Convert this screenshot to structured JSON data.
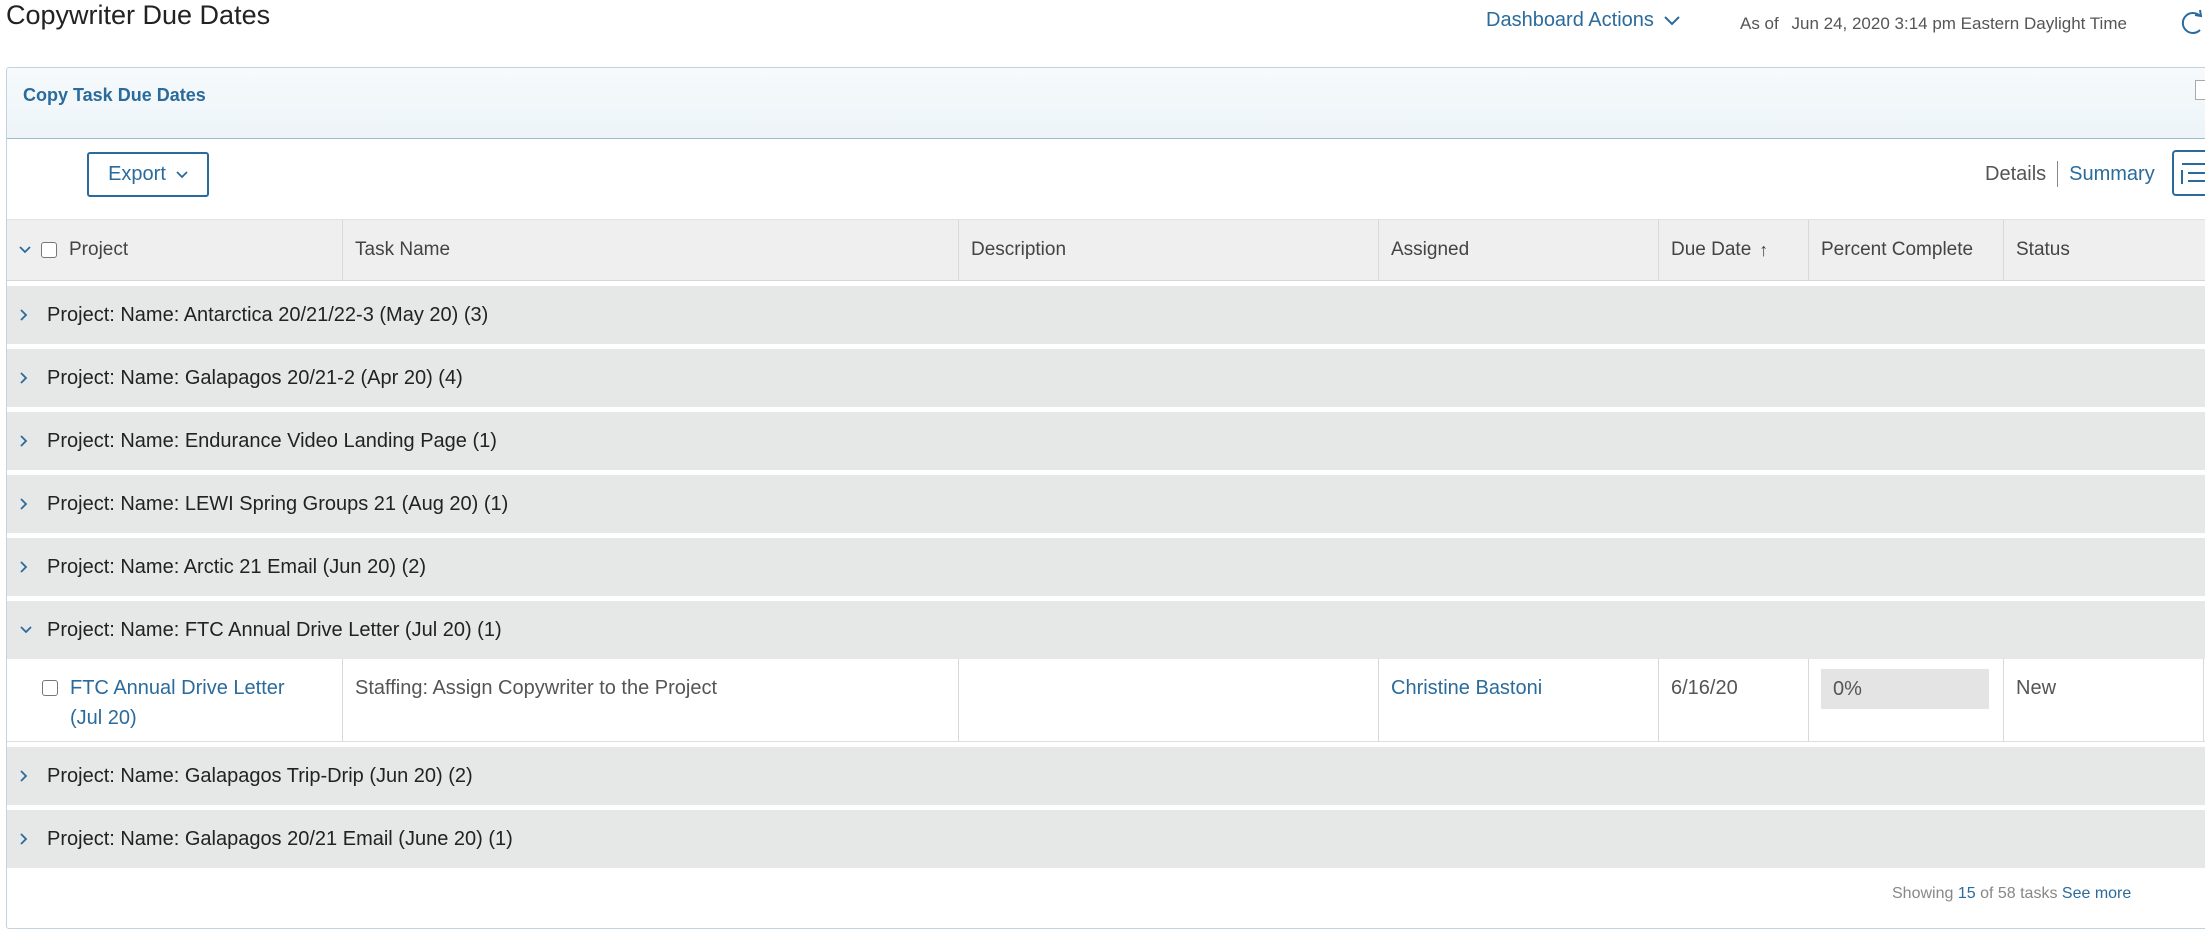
{
  "page": {
    "title": "Copywriter Due Dates",
    "dashboard_actions": "Dashboard Actions",
    "as_of_label": "As of",
    "as_of_value": "Jun 24, 2020 3:14 pm Eastern Daylight Time"
  },
  "panel": {
    "title": "Copy Task Due Dates"
  },
  "toolbar": {
    "export_label": "Export",
    "details_label": "Details",
    "summary_label": "Summary"
  },
  "columns": {
    "project": "Project",
    "task_name": "Task Name",
    "description": "Description",
    "assigned": "Assigned",
    "due_date": "Due Date",
    "percent_complete": "Percent Complete",
    "status": "Status"
  },
  "groups": [
    {
      "label": "Project: Name: Antarctica 20/21/22-3 (May 20) (3)",
      "expanded": false
    },
    {
      "label": "Project: Name: Galapagos 20/21-2 (Apr 20) (4)",
      "expanded": false
    },
    {
      "label": "Project: Name: Endurance Video Landing Page (1)",
      "expanded": false
    },
    {
      "label": "Project: Name: LEWI Spring Groups 21 (Aug 20) (1)",
      "expanded": false
    },
    {
      "label": "Project: Name: Arctic 21 Email (Jun 20) (2)",
      "expanded": false
    },
    {
      "label": "Project: Name: FTC Annual Drive Letter (Jul 20) (1)",
      "expanded": true,
      "rows": [
        {
          "project_line1": "FTC Annual Drive Letter",
          "project_line2": "(Jul 20)",
          "task_name": "Staffing: Assign Copywriter to the Project",
          "description": "",
          "assigned": "Christine Bastoni",
          "due_date": "6/16/20",
          "percent_complete": "0%",
          "status": "New"
        }
      ]
    },
    {
      "label": "Project: Name: Galapagos Trip-Drip (Jun 20) (2)",
      "expanded": false
    },
    {
      "label": "Project: Name: Galapagos 20/21 Email (June 20) (1)",
      "expanded": false
    }
  ],
  "footer": {
    "showing_label": "Showing",
    "page_size": "15",
    "of_label": "of 58 tasks",
    "see_more": "See more"
  }
}
